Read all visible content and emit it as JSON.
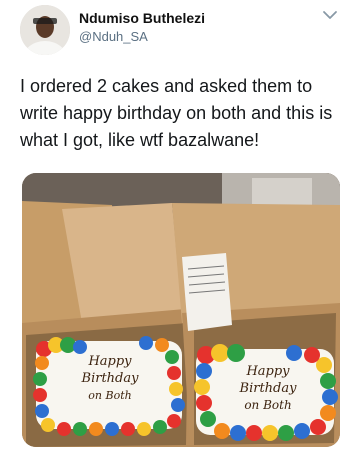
{
  "tweet": {
    "author_name": "Ndumiso Buthelezi",
    "author_handle": "@Nduh_SA",
    "text": "I ordered 2 cakes and asked them to write happy birthday on both and this is what I got, like wtf bazalwane!"
  },
  "cake_left": {
    "line1": "Happy",
    "line2": "Birthday",
    "line3": "on Both"
  },
  "cake_right": {
    "line1": "Happy",
    "line2": "Birthday",
    "line3": "on Both"
  },
  "icons": {
    "menu": "chevron-down-icon",
    "avatar": "avatar"
  },
  "colors": {
    "name": "#111111",
    "handle": "#5b7083",
    "text": "#14171a"
  }
}
